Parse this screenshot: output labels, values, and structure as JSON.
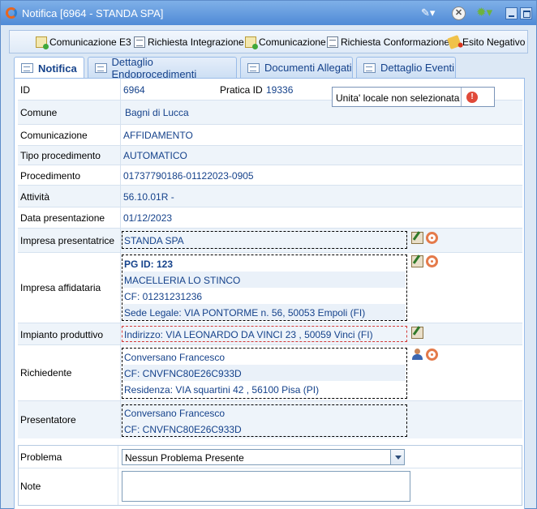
{
  "window": {
    "title": "Notifica [6964 - STANDA SPA]"
  },
  "titlebar": {
    "wrench_glyph": "✎▾",
    "close_glyph": "✕",
    "gear_glyph": "✹▾"
  },
  "toolbar": {
    "items": [
      {
        "label": "Comunicazione E3",
        "icon": "envelope-add-icon"
      },
      {
        "label": "Richiesta Integrazione",
        "icon": "document-icon"
      },
      {
        "label": "Comunicazione",
        "icon": "envelope-add-icon"
      },
      {
        "label": "Richiesta Conformazione",
        "icon": "document-icon"
      },
      {
        "label": "Esito Negativo",
        "icon": "negative-outcome-icon"
      }
    ]
  },
  "tabs": [
    {
      "label": "Notifica",
      "active": true
    },
    {
      "label": "Dettaglio Endoprocedimenti",
      "active": false
    },
    {
      "label": "Documenti Allegati",
      "active": false
    },
    {
      "label": "Dettaglio Eventi",
      "active": false
    }
  ],
  "fields": {
    "id": {
      "label": "ID",
      "value": "6964"
    },
    "pratica_id": {
      "label": "Pratica ID",
      "value": "19336"
    },
    "tooltip": {
      "text": "Unita' locale non selezionata",
      "icon": "warning-icon",
      "glyph": "!"
    },
    "comune": {
      "label": "Comune",
      "value": "Bagni di Lucca"
    },
    "comunicazione": {
      "label": "Comunicazione",
      "value": "AFFIDAMENTO"
    },
    "tipo_procedimento": {
      "label": "Tipo procedimento",
      "value": "AUTOMATICO"
    },
    "procedimento": {
      "label": "Procedimento",
      "value": "01737790186-01122023-0905"
    },
    "attivita": {
      "label": "Attività",
      "value": "56.10.01R -"
    },
    "data_presentazione": {
      "label": "Data presentazione",
      "value": "01/12/2023"
    },
    "impresa_presentatrice": {
      "label": "Impresa presentatrice",
      "value": "STANDA SPA"
    },
    "impresa_affidataria": {
      "label": "Impresa affidataria",
      "pg_id": "PG ID: 123",
      "name": "MACELLERIA LO STINCO",
      "cf": "CF: 01231231236",
      "sede": "Sede Legale: VIA PONTORME n. 56, 50053 Empoli (FI)"
    },
    "impianto_produttivo": {
      "label": "Impianto produttivo",
      "value": "Indirizzo: VIA LEONARDO DA VINCI 23 , 50059 Vinci (FI)"
    },
    "richiedente": {
      "label": "Richiedente",
      "name": "Conversano Francesco",
      "cf": "CF: CNVFNC80E26C933D",
      "residenza": "Residenza: VIA squartini 42 , 56100 Pisa (PI)"
    },
    "presentatore": {
      "label": "Presentatore",
      "name": "Conversano Francesco",
      "cf": "CF: CNVFNC80E26C933D"
    }
  },
  "lower": {
    "problema": {
      "label": "Problema",
      "selected": "Nessun Problema Presente"
    },
    "note": {
      "label": "Note",
      "value": ""
    }
  }
}
